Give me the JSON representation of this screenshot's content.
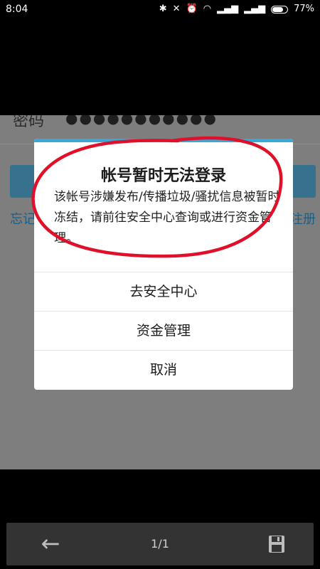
{
  "status_bar": {
    "time": "8:04",
    "battery": "77%",
    "icons": [
      "bluetooth-icon",
      "mute-icon",
      "alarm-icon",
      "wifi-icon",
      "signal-icon",
      "signal-icon",
      "battery-icon"
    ]
  },
  "background": {
    "password_label": "密码",
    "password_dots": "●●●●●●●●●●●",
    "forgot_label": "忘记",
    "register_label": "注册"
  },
  "dialog": {
    "title": "帐号暂时无法登录",
    "message": "该帐号涉嫌发布/传播垃圾/骚扰信息被暂时冻结，请前往安全中心查询或进行资金管理。",
    "buttons": [
      "去安全中心",
      "资金管理",
      "取消"
    ]
  },
  "bottom_bar": {
    "page_indicator": "1/1",
    "back_icon": "arrow-left-icon",
    "save_icon": "save-icon"
  },
  "colors": {
    "dialog_accent": "#3aa8d7",
    "annotation": "#e0102a",
    "link": "#1f5d82"
  }
}
